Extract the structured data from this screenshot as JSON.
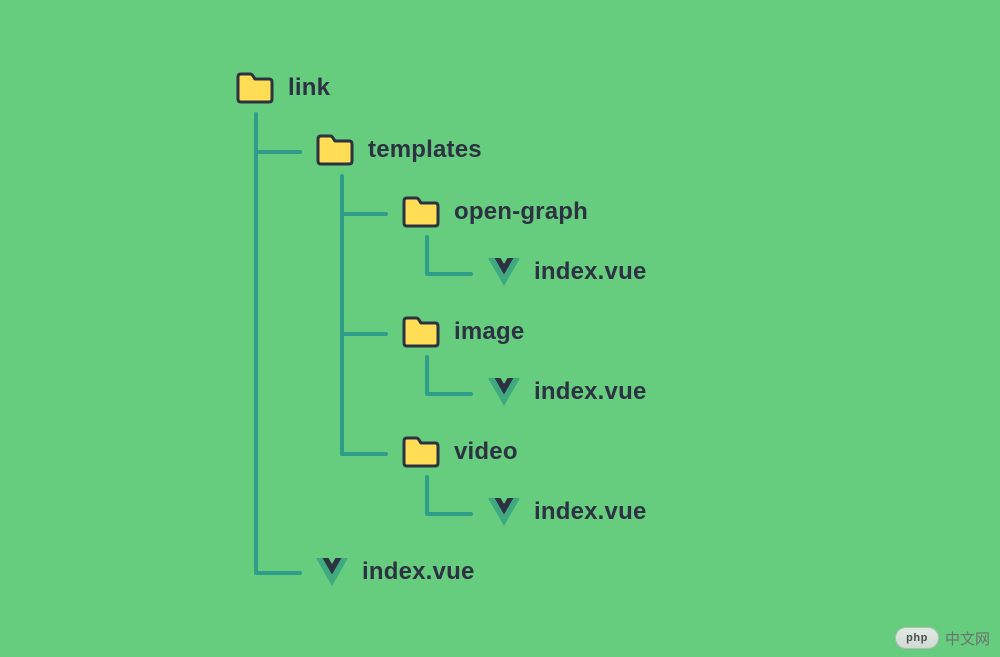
{
  "tree": {
    "root": {
      "label": "link",
      "icon": "folder"
    },
    "children": [
      {
        "label": "templates",
        "icon": "folder",
        "children": [
          {
            "label": "open-graph",
            "icon": "folder",
            "children": [
              {
                "label": "index.vue",
                "icon": "vue"
              }
            ]
          },
          {
            "label": "image",
            "icon": "folder",
            "children": [
              {
                "label": "index.vue",
                "icon": "vue"
              }
            ]
          },
          {
            "label": "video",
            "icon": "folder",
            "children": [
              {
                "label": "index.vue",
                "icon": "vue"
              }
            ]
          }
        ]
      },
      {
        "label": "index.vue",
        "icon": "vue"
      }
    ]
  },
  "watermark": {
    "brand": "php",
    "text": "中文网"
  },
  "colors": {
    "background": "#66cd7f",
    "connector": "#2f9d8a",
    "folderFill": "#ffdd55",
    "folderStroke": "#2c3241",
    "vueOuter": "#3fa97f",
    "vueInner": "#2c3241",
    "text": "#2c3241"
  }
}
